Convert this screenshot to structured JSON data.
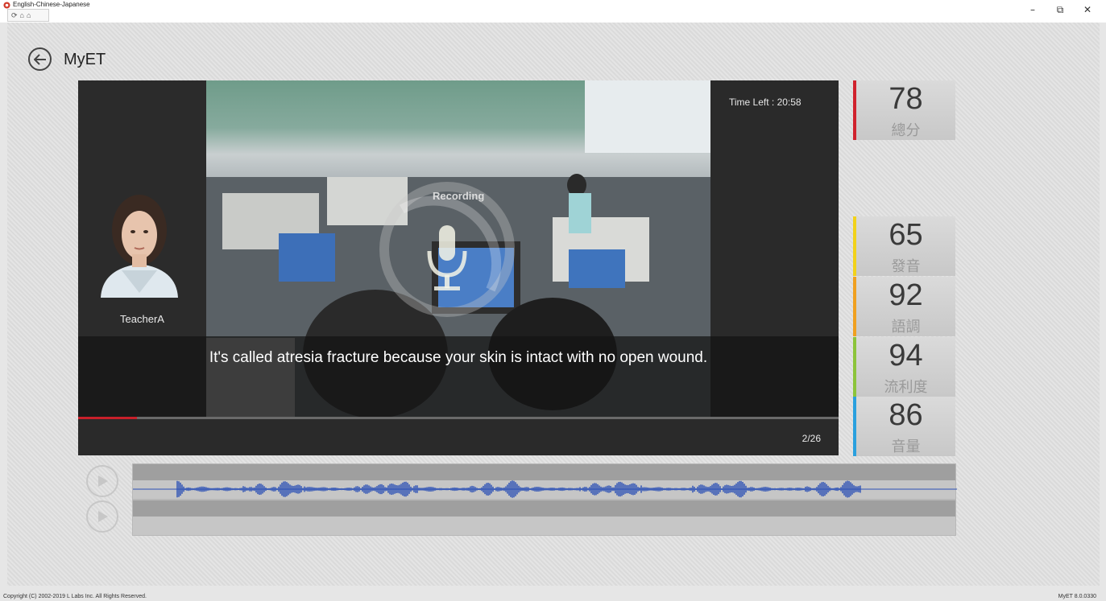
{
  "window": {
    "title": "English-Chinese-Japanese",
    "minimize": "–",
    "restore": "⧉",
    "close": "✕",
    "toolbar_icons": [
      "refresh-icon",
      "home-icon",
      "home-outline-icon"
    ]
  },
  "header": {
    "title": "MyET"
  },
  "video": {
    "teacher_name": "TeacherA",
    "time_left": "Time Left :  20:58",
    "recording_label": "Recording",
    "subtitle": "It's called atresia fracture because your skin is intact with no open wound.",
    "page_counter": "2/26",
    "progress": 0.077
  },
  "scores": [
    {
      "value": "78",
      "label": "總分",
      "color": "#d0222d"
    },
    {
      "value": "65",
      "label": "發音",
      "color": "#f2d21a"
    },
    {
      "value": "92",
      "label": "語調",
      "color": "#f0a020"
    },
    {
      "value": "94",
      "label": "流利度",
      "color": "#8cc43a"
    },
    {
      "value": "86",
      "label": "音量",
      "color": "#2aa0de"
    }
  ],
  "colors": {
    "accent": "#c8202a",
    "waveform": "#2a4fb5"
  },
  "footer": {
    "copyright": "Copyright (C) 2002-2019 L Labs Inc. All Rights Reserved.",
    "version": "MyET 8.0.0330"
  }
}
